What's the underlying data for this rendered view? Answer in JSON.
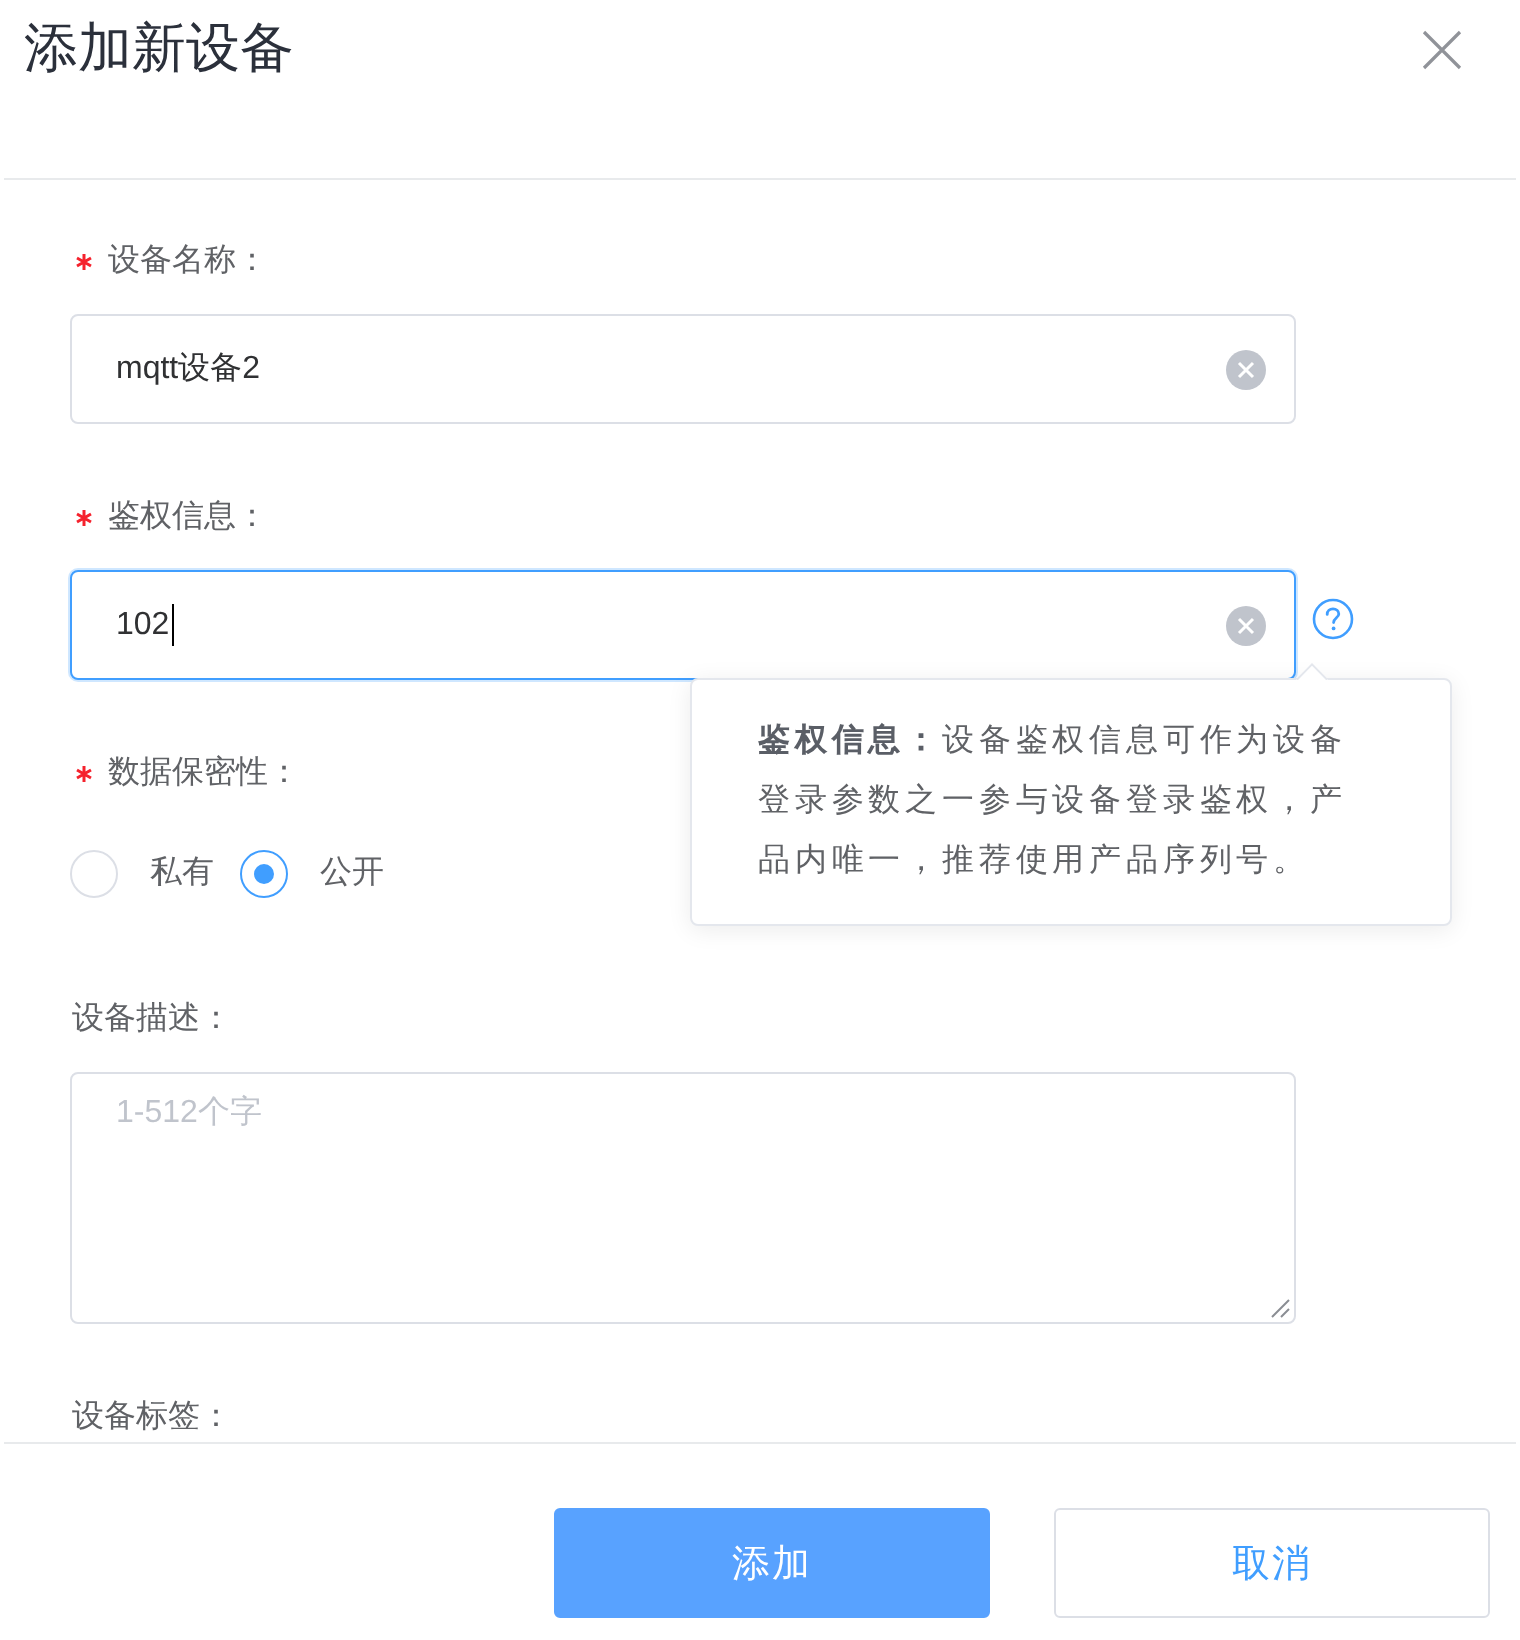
{
  "dialog": {
    "title": "添加新设备"
  },
  "form": {
    "fields": [
      {
        "kind": "text",
        "label": "设备名称：",
        "required": true,
        "value": "mqtt设备2",
        "focused": false,
        "clearable": true
      },
      {
        "kind": "text",
        "label": "鉴权信息：",
        "required": true,
        "value": "102",
        "focused": true,
        "clearable": true,
        "tooltip": {
          "text": "**鉴权信息：**设备鉴权信息可作为设备登录参数之一参与设备登录鉴权，产品内唯一，推荐使用产品序列号。"
        }
      },
      {
        "kind": "radio",
        "label": "数据保密性：",
        "required": true,
        "options": [
          {
            "label": "私有",
            "selected": false
          },
          {
            "label": "公开",
            "selected": true
          }
        ]
      },
      {
        "kind": "textarea",
        "label": "设备描述：",
        "required": false,
        "placeholder": "1-512个字"
      },
      {
        "kind": "tags",
        "label": "设备标签：",
        "required": false
      }
    ]
  },
  "buttons": [
    {
      "kind": "primary",
      "label": "添加"
    },
    {
      "kind": "secondary",
      "label": "取消"
    }
  ]
}
